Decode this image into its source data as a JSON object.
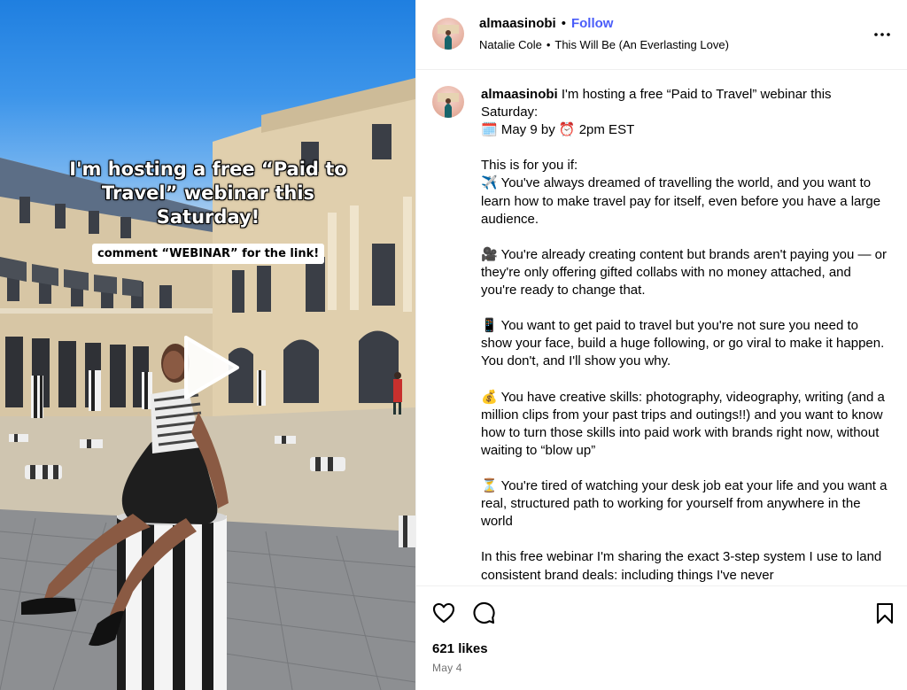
{
  "media": {
    "overlay_title": "I'm hosting a free “Paid to Travel” webinar this Saturday!",
    "overlay_pill": "comment “WEBINAR” for the link!"
  },
  "header": {
    "username": "almaasinobi",
    "dot": "•",
    "follow_label": "Follow",
    "audio_artist": "Natalie Cole",
    "audio_sep": "•",
    "audio_track": "This Will Be (An Everlasting Love)",
    "more_icon": "more-horizontal-icon"
  },
  "caption": {
    "username": "almaasinobi",
    "intro": " I'm hosting a free “Paid to Travel” webinar this Saturday:",
    "date_line": "🗓️ May 9 by ⏰ 2pm EST",
    "for_you": "This is for you if:",
    "p1": "✈️ You've always dreamed of travelling the world, and you want to learn how to make travel pay for itself, even before you have a large audience.",
    "p2": "🎥 You're already creating content but brands aren't paying you — or they're only offering gifted collabs with no money attached, and you're ready to change that.",
    "p3": "📱 You want to get paid to travel but you're not sure you need to show your face, build a huge following, or go viral to make it happen. You don't, and I'll show you why.",
    "p4": "💰 You have creative skills: photography, videography, writing (and a million clips from your past trips and outings!!) and you want to know how to turn those skills into paid work with brands right now, without waiting to “blow up”",
    "p5": "⏳ You're tired of watching your desk job eat your life and you want a real, structured path to working for yourself from anywhere in the world",
    "p6": "In this free webinar I'm sharing the exact 3-step system I use to land consistent brand deals: including things I've never"
  },
  "actions": {
    "like_icon": "heart-icon",
    "comment_icon": "comment-bubble-icon",
    "save_icon": "bookmark-icon",
    "likes": "621 likes",
    "date": "May 4"
  }
}
